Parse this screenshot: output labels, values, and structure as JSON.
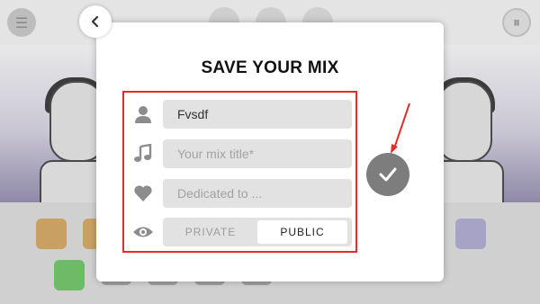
{
  "dialog": {
    "title": "SAVE YOUR MIX",
    "fields": {
      "author_value": "Fvsdf",
      "mix_title_placeholder": "Your mix title*",
      "dedicated_placeholder": "Dedicated to ..."
    },
    "visibility": {
      "options": [
        "PRIVATE",
        "PUBLIC"
      ],
      "selected": "PUBLIC"
    },
    "icons": {
      "back": "chevron-left-icon",
      "author": "user-icon",
      "title": "music-note-icon",
      "dedicated": "heart-icon",
      "visibility": "eye-icon",
      "confirm": "checkmark-icon"
    }
  },
  "background": {
    "menu_icon": "menu-icon",
    "pause_icon": "pause-icon"
  },
  "colors": {
    "annotation_red": "#e52b2b",
    "confirm_button": "#7d7d7d",
    "field_bg": "#e2e2e2"
  }
}
